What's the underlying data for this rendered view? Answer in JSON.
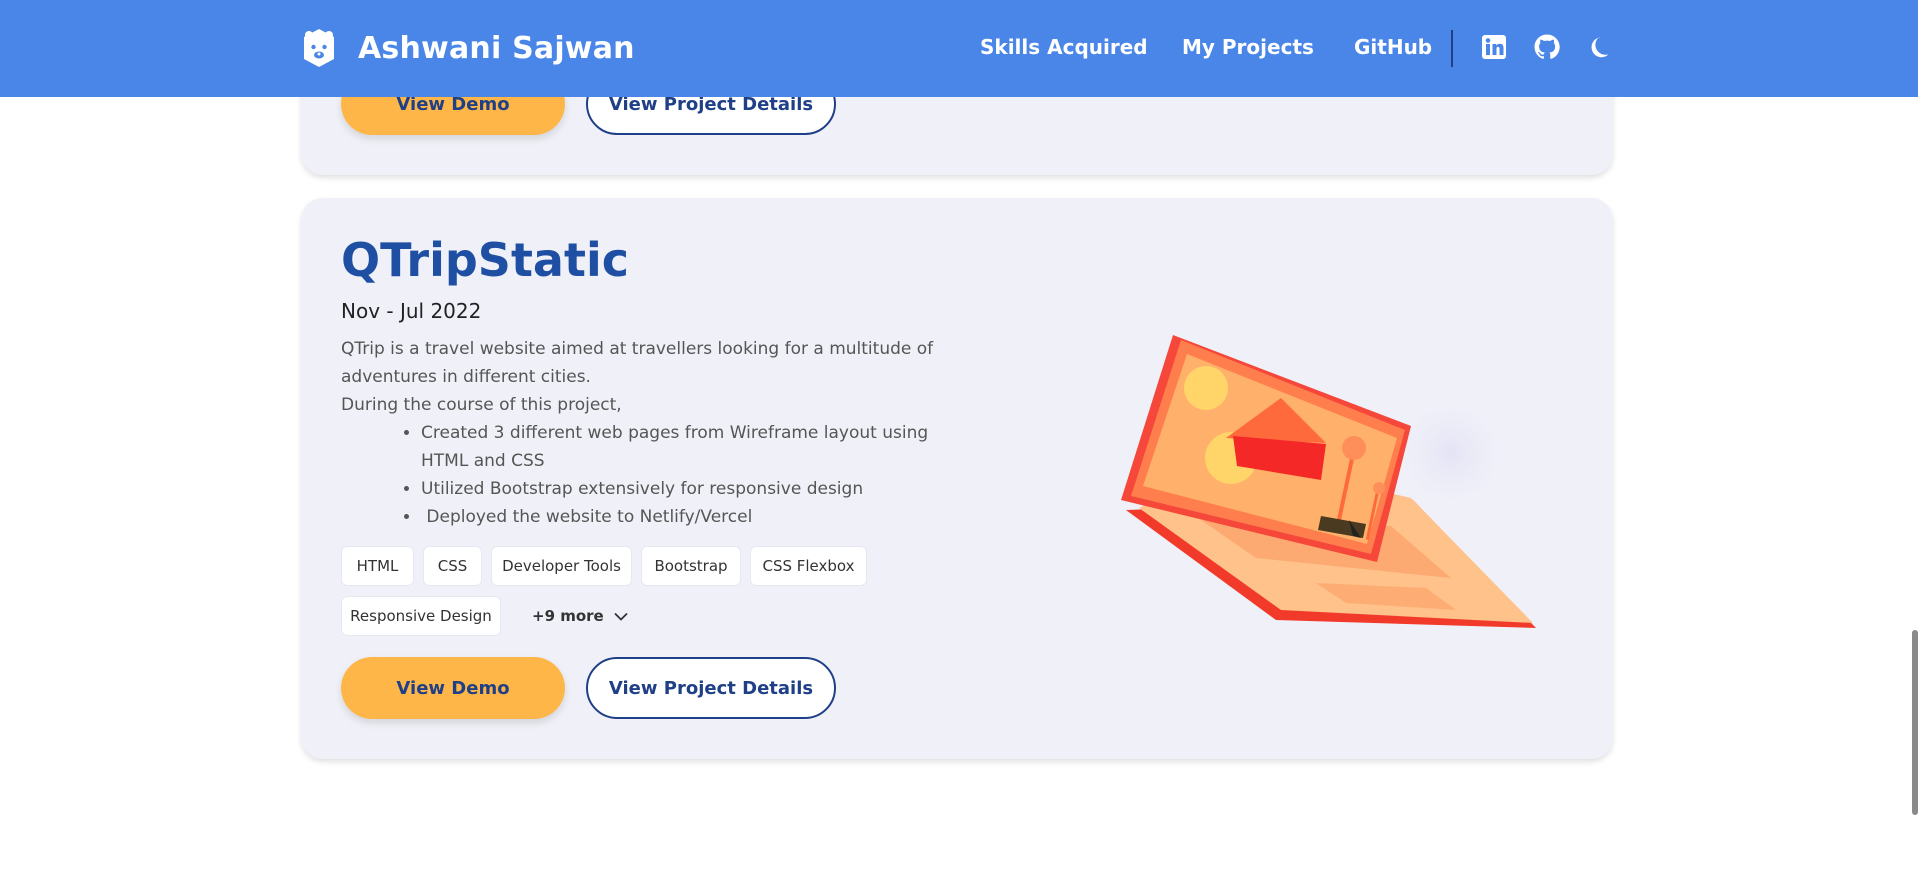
{
  "navbar": {
    "brand_name": "Ashwani Sajwan",
    "links": [
      "Skills Acquired",
      "My Projects",
      "GitHub"
    ],
    "icons": [
      "linkedin-icon",
      "github-icon",
      "moon-icon"
    ]
  },
  "previous_project": {
    "demo_label": "View Demo",
    "details_label": "View Project Details"
  },
  "project": {
    "title": "QTripStatic",
    "date": "Nov - Jul 2022",
    "description": "QTrip is a travel website aimed at travellers looking for a multitude of adventures in different cities.",
    "intro": "During the course of this project,",
    "bullets": [
      "Created 3 different web pages from Wireframe layout using HTML and CSS",
      "Utilized Bootstrap extensively for responsive design",
      " Deployed the website to Netlify/Vercel"
    ],
    "tags": [
      "HTML",
      "CSS",
      "Developer Tools",
      "Bootstrap",
      "CSS Flexbox",
      "Responsive Design"
    ],
    "more_label": "+9 more",
    "demo_label": "View Demo",
    "details_label": "View Project Details"
  },
  "colors": {
    "navbar": "#4a86e8",
    "accent_orange": "#ffb648",
    "title_blue": "#1f4fa3",
    "card_bg": "#f0f1f8"
  }
}
